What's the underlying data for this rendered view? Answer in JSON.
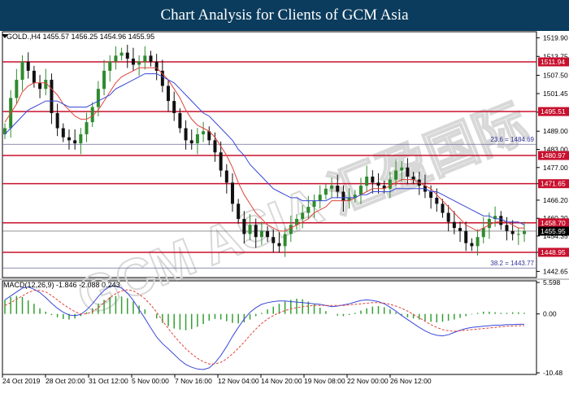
{
  "banner": {
    "title": "Chart Analysis for Clients of GCM Asia"
  },
  "chart_data": {
    "type": "line",
    "symbol_header": "GOLD.,H4  1455.57 1456.25 1454.96 1455.95",
    "current_price": 1455.95,
    "ylim": [
      1440.6,
      1521.9
    ],
    "price_ticks": [
      1519.9,
      1513.75,
      1507.5,
      1501.45,
      1495.3,
      1489.0,
      1483.0,
      1477.0,
      1471.65,
      1466.2,
      1460.2,
      1454.35,
      1448.95,
      1442.65
    ],
    "horizontal_levels": [
      {
        "value": 1511.94,
        "label": "1511.94",
        "color": "#c8102e"
      },
      {
        "value": 1495.51,
        "label": "1495.51",
        "color": "#c8102e"
      },
      {
        "value": 1480.97,
        "label": "1480.97",
        "color": "#c8102e"
      },
      {
        "value": 1471.65,
        "label": "1471.65",
        "color": "#c8102e"
      },
      {
        "value": 1458.7,
        "label": "1458.70",
        "color": "#c8102e"
      },
      {
        "value": 1448.95,
        "label": "1448.95",
        "color": "#c8102e"
      }
    ],
    "fib_levels": [
      {
        "value": 1484.69,
        "label": "23.6 = 1484.69"
      },
      {
        "value": 1443.77,
        "label": "38.2 = 1443.77"
      }
    ],
    "x_labels": [
      "24 Oct 2019",
      "28 Oct 20:00",
      "31 Oct 12:00",
      "5 Nov 00:00",
      "7 Nov 16:00",
      "12 Nov 04:00",
      "14 Nov 20:00",
      "19 Nov 08:00",
      "22 Nov 00:00",
      "26 Nov 12:00"
    ],
    "close_series": [
      1490,
      1500,
      1506,
      1512,
      1509,
      1505,
      1503,
      1506,
      1495,
      1490,
      1487,
      1486,
      1485,
      1488,
      1492,
      1497,
      1503,
      1509,
      1512,
      1514,
      1515,
      1513,
      1511,
      1512,
      1514,
      1512,
      1509,
      1504,
      1499,
      1495,
      1490,
      1486,
      1485,
      1488,
      1489,
      1486,
      1482,
      1476,
      1472,
      1465,
      1460,
      1455,
      1458,
      1454,
      1456,
      1454,
      1452,
      1451,
      1455,
      1458,
      1460,
      1462,
      1464,
      1466,
      1468,
      1470,
      1471,
      1469,
      1466,
      1467,
      1468,
      1471,
      1474,
      1472,
      1471,
      1470,
      1473,
      1476,
      1477,
      1474,
      1473,
      1471,
      1469,
      1467,
      1465,
      1462,
      1459,
      1457,
      1456,
      1452,
      1451,
      1454,
      1457,
      1460,
      1461,
      1458,
      1456,
      1455,
      1455,
      1456
    ],
    "series": [
      {
        "values": [
          1492,
          1495,
          1498,
          1502,
          1504,
          1505,
          1505,
          1505,
          1503,
          1501,
          1498,
          1496,
          1494,
          1493,
          1493,
          1494,
          1496,
          1499,
          1502,
          1505,
          1507,
          1508,
          1509,
          1510,
          1510,
          1510,
          1510,
          1508,
          1506,
          1503,
          1500,
          1496,
          1493,
          1491,
          1490,
          1489,
          1487,
          1484,
          1481,
          1477,
          1472,
          1468,
          1465,
          1462,
          1460,
          1458,
          1457,
          1456,
          1456,
          1457,
          1458,
          1459,
          1460,
          1462,
          1463,
          1464,
          1466,
          1466,
          1466,
          1466,
          1467,
          1468,
          1469,
          1470,
          1470,
          1470,
          1471,
          1472,
          1473,
          1473,
          1473,
          1472,
          1471,
          1470,
          1468,
          1466,
          1464,
          1462,
          1460,
          1458,
          1457,
          1456,
          1457,
          1458,
          1459,
          1459,
          1459,
          1458,
          1457,
          1457
        ],
        "color": "#e0443c"
      },
      {
        "values": [
          1488,
          1490,
          1492,
          1494,
          1496,
          1497,
          1498,
          1499,
          1499,
          1499,
          1498,
          1497,
          1497,
          1497,
          1497,
          1498,
          1499,
          1500,
          1501,
          1503,
          1504,
          1505,
          1506,
          1507,
          1508,
          1508,
          1508,
          1507,
          1506,
          1505,
          1503,
          1501,
          1499,
          1497,
          1495,
          1494,
          1492,
          1490,
          1488,
          1486,
          1483,
          1481,
          1478,
          1476,
          1474,
          1472,
          1470,
          1469,
          1468,
          1467,
          1467,
          1466,
          1466,
          1466,
          1466,
          1466,
          1467,
          1467,
          1467,
          1467,
          1467,
          1468,
          1468,
          1469,
          1469,
          1469,
          1469,
          1470,
          1470,
          1470,
          1470,
          1470,
          1470,
          1469,
          1469,
          1468,
          1467,
          1466,
          1465,
          1464,
          1463,
          1462,
          1461,
          1461,
          1460,
          1460,
          1459,
          1459,
          1459,
          1458
        ],
        "color": "#3a48d8"
      }
    ],
    "macd": {
      "header": "MACD(12,26,9) -1.846 -2.088 0.243",
      "ylim": [
        -10.48,
        5.598
      ],
      "ticks": [
        5.598,
        0.0,
        -10.48
      ],
      "histogram": [
        2.5,
        3.0,
        3.2,
        3.0,
        2.4,
        1.8,
        1.0,
        0.4,
        -0.2,
        -0.6,
        -0.9,
        -1.0,
        -0.8,
        -0.4,
        0.3,
        1.0,
        1.8,
        2.5,
        3.0,
        3.2,
        3.1,
        2.8,
        2.2,
        1.5,
        0.8,
        0.0,
        -0.8,
        -1.6,
        -2.2,
        -2.6,
        -2.8,
        -2.9,
        -2.7,
        -2.3,
        -1.8,
        -1.2,
        -0.9,
        -1.0,
        -1.3,
        -1.6,
        -1.7,
        -1.5,
        -1.0,
        -0.4,
        0.2,
        0.8,
        1.3,
        1.8,
        2.2,
        2.5,
        2.7,
        2.6,
        2.2,
        1.7,
        1.1,
        0.5,
        0.0,
        -0.3,
        -0.4,
        -0.2,
        0.2,
        0.6,
        1.0,
        1.3,
        1.4,
        1.2,
        0.8,
        0.3,
        -0.2,
        -0.6,
        -0.8,
        -1.0,
        -1.2,
        -1.4,
        -1.5,
        -1.4,
        -1.2,
        -1.0,
        -0.7,
        -0.4,
        -0.1,
        0.2,
        0.4,
        0.4,
        0.3,
        0.2,
        0.2,
        0.3,
        0.3,
        0.2
      ],
      "macd_line": [
        2.5,
        3.2,
        3.9,
        4.6,
        4.8,
        4.4,
        3.8,
        2.9,
        1.9,
        1.0,
        0.3,
        -0.2,
        -0.3,
        -0.1,
        0.7,
        1.8,
        3.1,
        4.2,
        4.9,
        5.0,
        4.6,
        3.7,
        2.4,
        0.8,
        -0.8,
        -2.5,
        -4.1,
        -5.3,
        -6.2,
        -7.2,
        -8.2,
        -9.0,
        -9.5,
        -9.8,
        -9.9,
        -9.6,
        -8.7,
        -7.4,
        -5.8,
        -4.0,
        -2.4,
        -0.9,
        0.3,
        1.1,
        1.7,
        2.0,
        2.2,
        2.3,
        2.3,
        2.2,
        2.1,
        2.0,
        1.9,
        1.8,
        1.7,
        1.5,
        1.3,
        1.4,
        1.6,
        1.8,
        2.1,
        2.4,
        2.5,
        2.4,
        2.2,
        1.8,
        1.2,
        0.5,
        -0.3,
        -1.0,
        -1.7,
        -2.4,
        -3.0,
        -3.5,
        -3.8,
        -3.9,
        -3.7,
        -3.3,
        -2.9,
        -2.6,
        -2.4,
        -2.3,
        -2.2,
        -2.1,
        -2.0,
        -2.0,
        -1.9,
        -1.9,
        -1.85,
        -1.85
      ],
      "macd_color": "#3a48d8",
      "signal_line": [
        1.5,
        2.0,
        2.6,
        3.2,
        3.8,
        4.2,
        4.2,
        3.9,
        3.3,
        2.5,
        1.7,
        1.0,
        0.4,
        0.0,
        0.0,
        0.4,
        1.1,
        2.0,
        2.9,
        3.6,
        4.1,
        4.3,
        4.1,
        3.5,
        2.7,
        1.6,
        0.3,
        -1.2,
        -2.6,
        -3.9,
        -5.1,
        -6.2,
        -7.1,
        -7.9,
        -8.5,
        -8.9,
        -8.9,
        -8.6,
        -8.0,
        -7.1,
        -6.1,
        -5.0,
        -3.8,
        -2.7,
        -1.7,
        -0.9,
        -0.3,
        0.2,
        0.6,
        0.9,
        1.1,
        1.3,
        1.4,
        1.5,
        1.5,
        1.5,
        1.5,
        1.5,
        1.5,
        1.6,
        1.7,
        1.8,
        1.9,
        2.0,
        2.0,
        1.9,
        1.7,
        1.4,
        1.0,
        0.5,
        -0.1,
        -0.7,
        -1.3,
        -1.9,
        -2.4,
        -2.8,
        -3.0,
        -3.1,
        -3.0,
        -2.9,
        -2.8,
        -2.7,
        -2.6,
        -2.5,
        -2.4,
        -2.3,
        -2.2,
        -2.15,
        -2.1,
        -2.09
      ],
      "signal_color": "#e0443c"
    },
    "watermark": "GCM ASIA 汇盈国际",
    "colors": {
      "bull": "#2e8b2e",
      "bear": "#111111",
      "level": "#c8102e",
      "current": "#555555",
      "hist": "#33a033"
    }
  }
}
